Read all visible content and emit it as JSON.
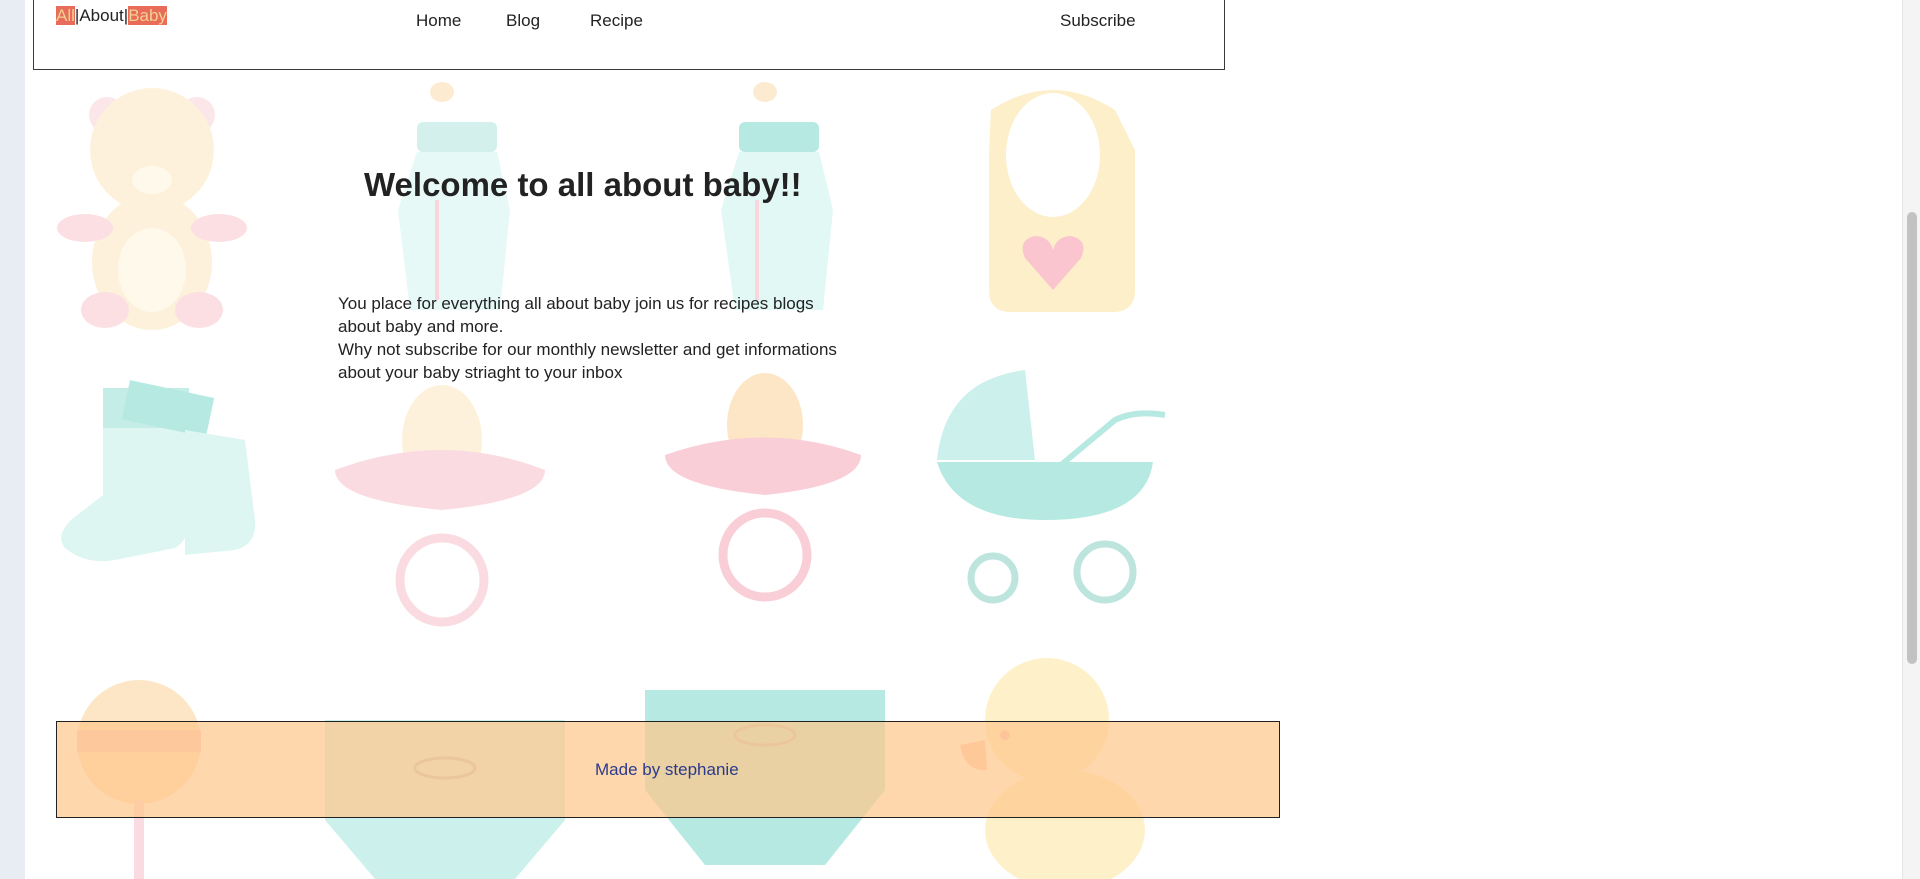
{
  "header": {
    "logo": {
      "part1": "All",
      "sep1": "|",
      "part2": "About",
      "sep2": "|",
      "part3": "Baby"
    },
    "nav": [
      {
        "label": "Home"
      },
      {
        "label": "Blog"
      },
      {
        "label": "Recipe"
      },
      {
        "label": "Subscribe"
      }
    ]
  },
  "main": {
    "title": "Welcome to all about baby!!",
    "intro_line1": "You place for everything all about baby join us for recipes blogs about baby and more.",
    "intro_line2": "Why not subscribe for our monthly newsletter and get informations about your baby striaght to your inbox"
  },
  "footer": {
    "text": "Made by stephanie"
  },
  "colors": {
    "logo_highlight": "#e96b5a",
    "logo_highlight_text": "#f1d18f",
    "footer_bg": "#ffc88c",
    "footer_text": "#2b3a8c"
  },
  "background_icons": [
    "teddy-bear-icon",
    "baby-bottle-icon",
    "baby-bottle-icon",
    "bib-icon",
    "socks-icon",
    "pacifier-icon",
    "pacifier-icon",
    "stroller-icon",
    "rattle-icon",
    "diaper-icon",
    "diaper-icon",
    "rubber-duck-icon"
  ]
}
